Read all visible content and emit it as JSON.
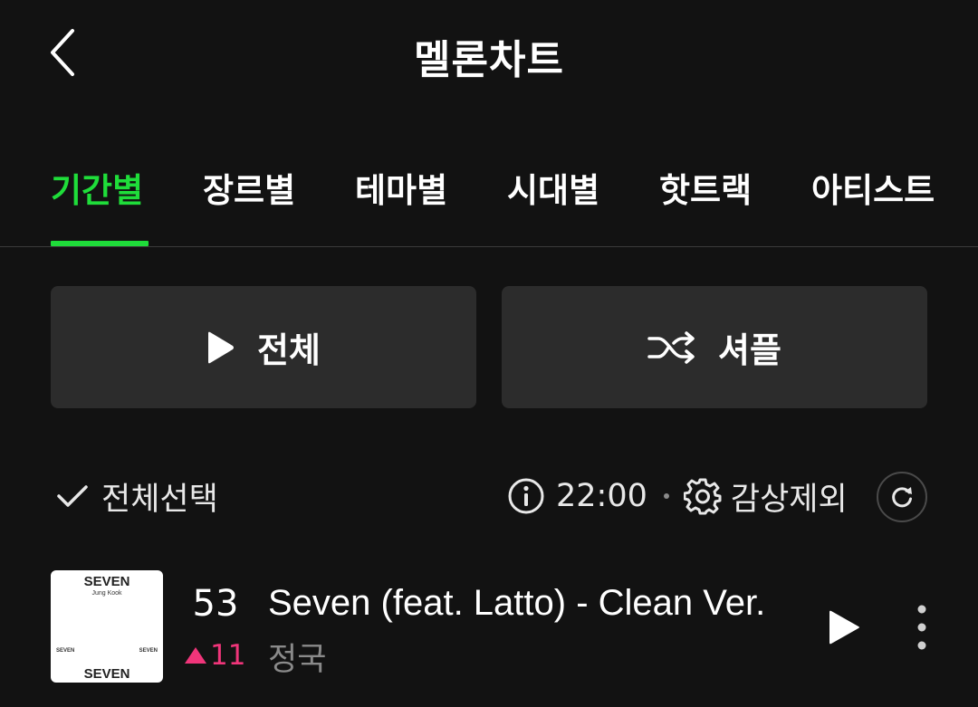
{
  "header": {
    "title": "멜론차트",
    "back_icon": "chevron-left-icon"
  },
  "tabs": [
    {
      "label": "기간별",
      "active": true
    },
    {
      "label": "장르별",
      "active": false
    },
    {
      "label": "테마별",
      "active": false
    },
    {
      "label": "시대별",
      "active": false
    },
    {
      "label": "핫트랙",
      "active": false
    },
    {
      "label": "아티스트",
      "active": false
    }
  ],
  "actions": {
    "play_all": {
      "label": "전체",
      "icon": "play-icon"
    },
    "shuffle": {
      "label": "셔플",
      "icon": "shuffle-icon"
    }
  },
  "toolbar": {
    "select_all_label": "전체선택",
    "update_time": "22:00",
    "exclude_label": "감상제외",
    "info_icon": "info-icon",
    "settings_icon": "gear-icon",
    "refresh_icon": "refresh-icon"
  },
  "songs": [
    {
      "rank": "53",
      "rank_change": "11",
      "rank_direction": "up",
      "title": "Seven (feat. Latto) - Clean Ver.",
      "artist": "정국",
      "album_art": {
        "title": "SEVEN",
        "subtitle": "Jung Kook",
        "mid_left": "SEVEN",
        "mid_right": "SEVEN",
        "bottom": "SEVEN"
      }
    }
  ],
  "colors": {
    "background": "#121212",
    "accent": "#1fdd3a",
    "rank_up": "#f0357a",
    "button_bg": "#2c2c2c",
    "muted_text": "#8a8a8a"
  }
}
